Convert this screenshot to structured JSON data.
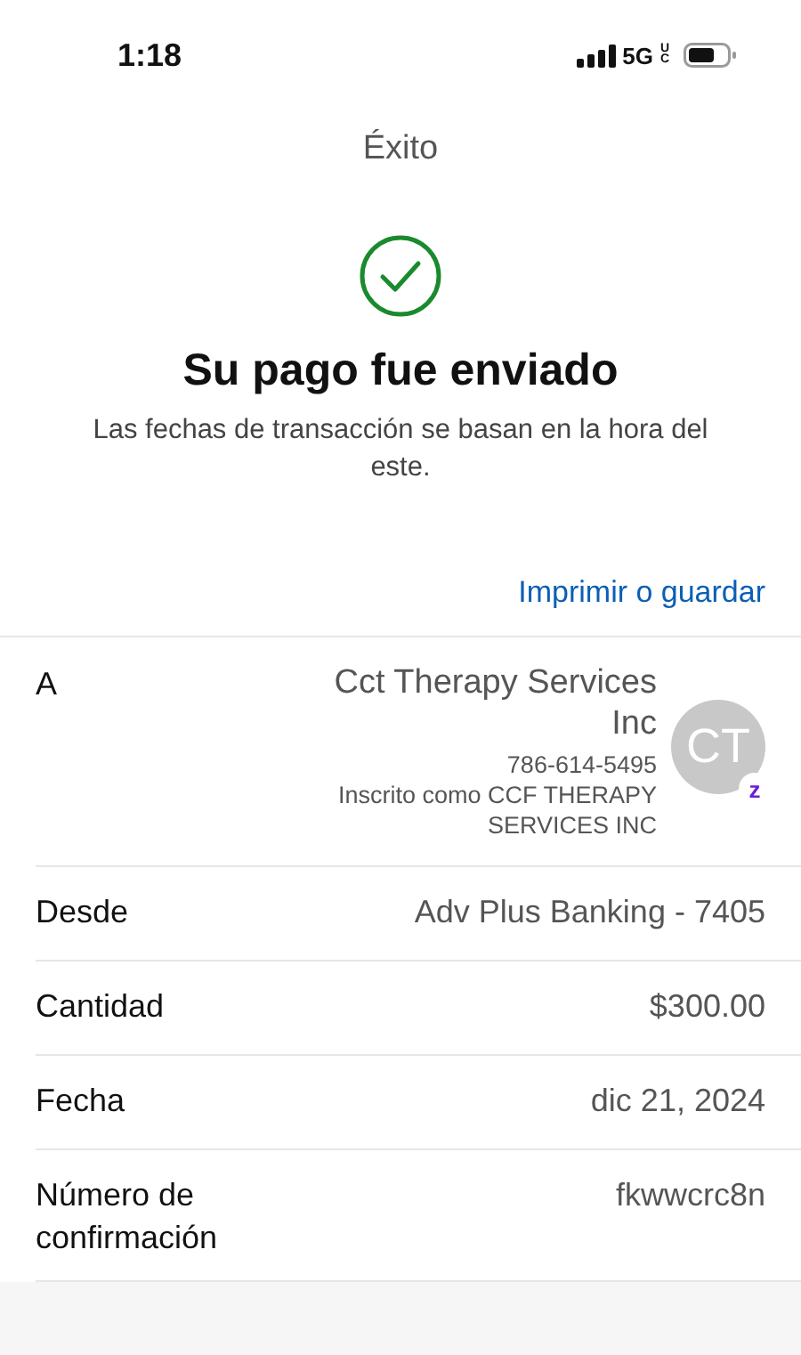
{
  "status_bar": {
    "time": "1:18",
    "network": "5G",
    "network_badge": "UC"
  },
  "header": {
    "title": "Éxito"
  },
  "result": {
    "heading": "Su pago fue enviado",
    "note": "Las fechas de transacción se basan en la hora del este."
  },
  "print_link": "Imprimir o guardar",
  "details": [
    {
      "kind": "recipient",
      "label": "A",
      "name": "Cct Therapy Services Inc",
      "phone": "786-614-5495",
      "registered": "Inscrito como CCF THERAPY SERVICES INC",
      "avatar": "CT",
      "badge": "z"
    },
    {
      "kind": "plain",
      "label": "Desde",
      "value": "Adv Plus Banking - 7405"
    },
    {
      "kind": "plain",
      "label": "Cantidad",
      "value": "$300.00"
    },
    {
      "kind": "plain",
      "label": "Fecha",
      "value": "dic 21, 2024"
    },
    {
      "kind": "plain",
      "label": "Número de confirmación",
      "value": "fkwwcrc8n"
    }
  ]
}
